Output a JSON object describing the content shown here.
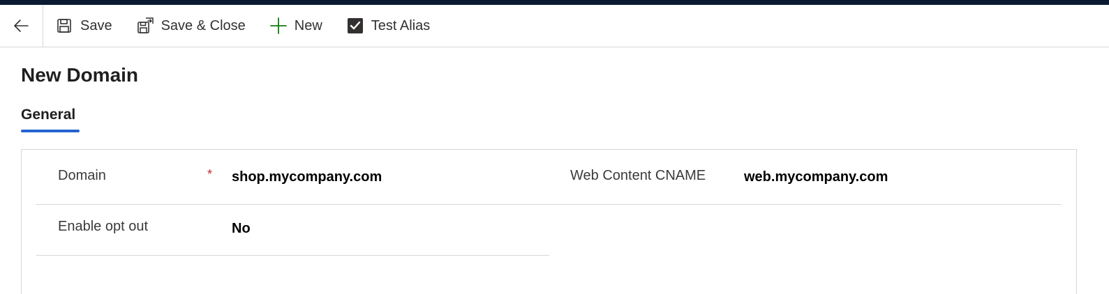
{
  "toolbar": {
    "save_label": "Save",
    "save_close_label": "Save & Close",
    "new_label": "New",
    "test_alias_label": "Test Alias"
  },
  "page": {
    "title": "New Domain"
  },
  "tabs": [
    {
      "label": "General",
      "selected": true
    }
  ],
  "form": {
    "domain": {
      "label": "Domain",
      "required_marker": "*",
      "value": "shop.mycompany.com"
    },
    "web_content_cname": {
      "label": "Web Content CNAME",
      "value": "web.mycompany.com"
    },
    "enable_opt_out": {
      "label": "Enable opt out",
      "value": "No"
    }
  },
  "icons": {
    "back": "back-arrow-icon",
    "save": "save-icon",
    "save_close": "save-close-icon",
    "new": "plus-icon",
    "test_alias": "checkbox-checked-icon"
  },
  "colors": {
    "top_bar": "#0b1a33",
    "accent": "#2564cf",
    "new_icon": "#107c10",
    "required": "#c4262e"
  }
}
